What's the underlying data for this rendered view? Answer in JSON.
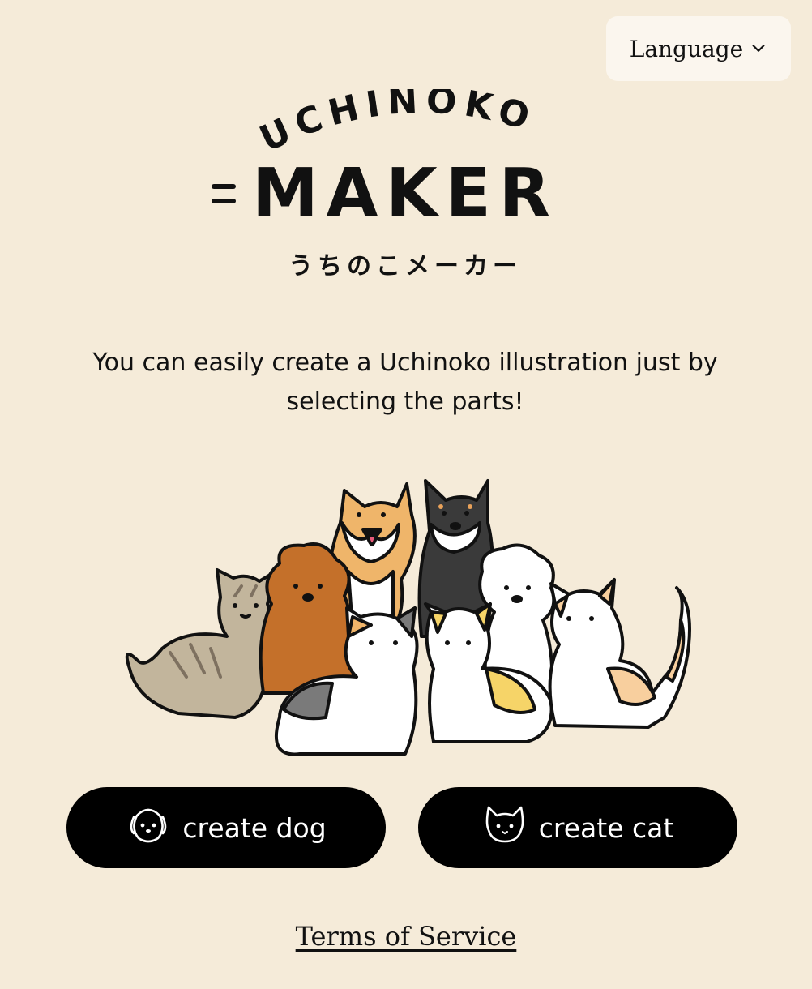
{
  "header": {
    "language_label": "Language",
    "language_icon": "chevron-down-icon"
  },
  "logo": {
    "top_text": "UCHINOKO",
    "main_text": "MAKER",
    "subtitle_jp": "うちのこメーカー"
  },
  "intro": {
    "tagline": "You can easily create a Uchinoko illustration just by selecting the parts!"
  },
  "actions": {
    "dog_label": "create dog",
    "dog_icon": "dog-face-icon",
    "cat_label": "create cat",
    "cat_icon": "cat-face-icon"
  },
  "footer": {
    "terms_label": "Terms of Service"
  },
  "colors": {
    "background": "#f5ebd9",
    "button": "#000000",
    "language_bg": "#fbf6ee"
  }
}
